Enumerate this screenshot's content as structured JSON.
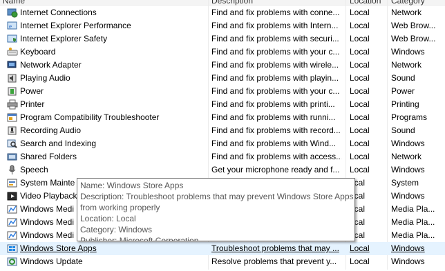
{
  "header": {
    "name": "Name",
    "description": "Description",
    "location": "Location",
    "category": "Category"
  },
  "rows": [
    {
      "name": "Internet Connections",
      "description": "Find and fix problems with conne...",
      "location": "Local",
      "category": "Network",
      "icon": "network-globe-icon"
    },
    {
      "name": "Internet Explorer Performance",
      "description": "Find and fix problems with Intern...",
      "location": "Local",
      "category": "Web Brow...",
      "icon": "ie-performance-icon"
    },
    {
      "name": "Internet Explorer Safety",
      "description": "Find and fix problems with securi...",
      "location": "Local",
      "category": "Web Brow...",
      "icon": "ie-safety-icon"
    },
    {
      "name": "Keyboard",
      "description": "Find and fix problems with your c...",
      "location": "Local",
      "category": "Windows",
      "icon": "keyboard-icon"
    },
    {
      "name": "Network Adapter",
      "description": "Find and fix problems with wirele...",
      "location": "Local",
      "category": "Network",
      "icon": "network-adapter-icon"
    },
    {
      "name": "Playing Audio",
      "description": "Find and fix problems with playin...",
      "location": "Local",
      "category": "Sound",
      "icon": "speaker-icon"
    },
    {
      "name": "Power",
      "description": "Find and fix problems with your c...",
      "location": "Local",
      "category": "Power",
      "icon": "power-icon"
    },
    {
      "name": "Printer",
      "description": "Find and fix problems with printi...",
      "location": "Local",
      "category": "Printing",
      "icon": "printer-icon"
    },
    {
      "name": "Program Compatibility Troubleshooter",
      "description": "Find and fix problems with runni...",
      "location": "Local",
      "category": "Programs",
      "icon": "program-compat-icon"
    },
    {
      "name": "Recording Audio",
      "description": "Find and fix problems with record...",
      "location": "Local",
      "category": "Sound",
      "icon": "microphone-icon"
    },
    {
      "name": "Search and Indexing",
      "description": "Find and fix problems with Wind...",
      "location": "Local",
      "category": "Windows",
      "icon": "search-icon"
    },
    {
      "name": "Shared Folders",
      "description": "Find and fix problems with access...",
      "location": "Local",
      "category": "Network",
      "icon": "shared-folder-icon"
    },
    {
      "name": "Speech",
      "description": "Get your microphone ready and f...",
      "location": "Local",
      "category": "Windows",
      "icon": "speech-microphone-icon"
    },
    {
      "name": "System Mainte",
      "description": "",
      "location": "ocal",
      "category": "System",
      "icon": "system-maintenance-icon"
    },
    {
      "name": "Video Playback",
      "description": "",
      "location": "ocal",
      "category": "Windows",
      "icon": "video-playback-icon"
    },
    {
      "name": "Windows Medi",
      "description": "",
      "location": "ocal",
      "category": "Media Pla...",
      "icon": "media-player-icon"
    },
    {
      "name": "Windows Medi",
      "description": "",
      "location": "ocal",
      "category": "Media Pla...",
      "icon": "media-player-icon"
    },
    {
      "name": "Windows Medi",
      "description": "",
      "location": "ocal",
      "category": "Media Pla...",
      "icon": "media-player-icon"
    },
    {
      "name": "Windows Store Apps",
      "description": "Troubleshoot problems that may ...",
      "location": "Local",
      "category": "Windows",
      "icon": "windows-store-icon",
      "hover": true
    },
    {
      "name": "Windows Update",
      "description": "Resolve problems that prevent y...",
      "location": "Local",
      "category": "Windows",
      "icon": "windows-update-icon"
    }
  ],
  "tooltip": {
    "line1": "Name: Windows Store Apps",
    "line2": "Description: Troubleshoot problems that may prevent Windows Store Apps",
    "line3": "from working properly",
    "line4": "Location: Local",
    "line5": "Category: Windows",
    "line6": "Publisher: Microsoft Corporation"
  },
  "colors": {
    "hover_row": "#e5f3ff",
    "tooltip_border": "#767676",
    "tooltip_text": "#575757"
  }
}
